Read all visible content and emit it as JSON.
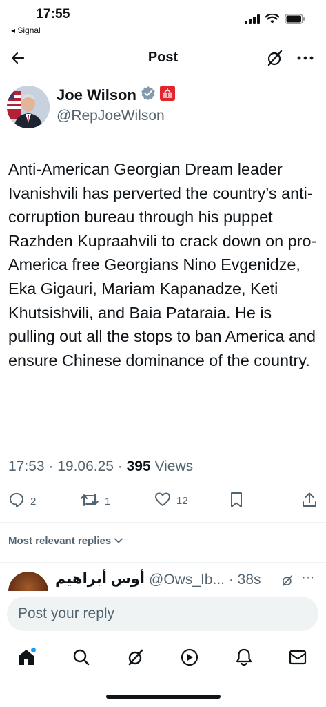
{
  "status_bar": {
    "time": "17:55",
    "back_app": "◂ Signal"
  },
  "header": {
    "title": "Post"
  },
  "author": {
    "name": "Joe Wilson",
    "handle": "@RepJoeWilson"
  },
  "post": {
    "text": "Anti-American Georgian Dream leader Ivanishvili has perverted the country’s anti-corruption bureau through his puppet Razhden Kupraahvili to crack down on pro-America free Georgians Nino Evgenidze, Eka Gigauri, Mariam Kapanadze, Keti Khutsishvili, and Baia Pataraia. He is pulling out all the stops to ban America and ensure Chinese dominance of the country.",
    "timestamp": "17:53 · 19.06.25 · ",
    "views_count": "395",
    "views_label": " Views"
  },
  "actions": {
    "replies": "2",
    "reposts": "1",
    "likes": "12"
  },
  "replies_filter": {
    "label": "Most relevant replies"
  },
  "reply_preview": {
    "name": "أوس أبراهيم",
    "handle_time": "@Ows_Ib... · 38s",
    "more": "···"
  },
  "composer": {
    "placeholder": "Post your reply"
  },
  "colors": {
    "accent": "#1d9bf0",
    "secondary_text": "#536471",
    "verified": "#829aab",
    "gov_badge": "#e3262d"
  }
}
